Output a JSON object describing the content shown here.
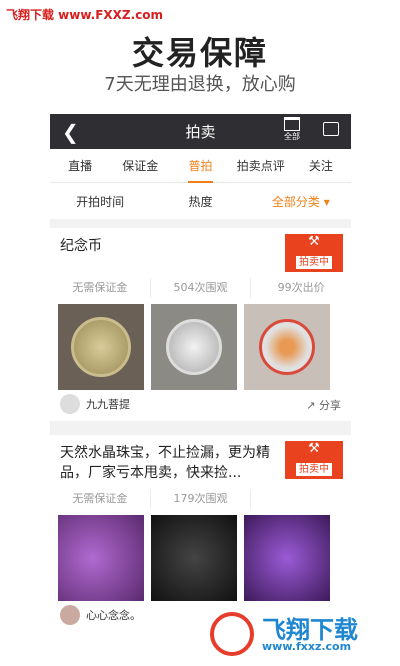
{
  "watermark_top": "飞翔下载 www.FXXZ.com",
  "promo": {
    "title": "交易保障",
    "subtitle": "7天无理由退换，放心购"
  },
  "nav": {
    "title": "拍卖",
    "calendar_label": "全部"
  },
  "tabs": [
    {
      "label": "直播"
    },
    {
      "label": "保证金"
    },
    {
      "label": "普拍",
      "active": true
    },
    {
      "label": "拍卖点评"
    },
    {
      "label": "关注"
    }
  ],
  "filters": [
    {
      "label": "开拍时间"
    },
    {
      "label": "热度"
    },
    {
      "label": "全部分类 ▾",
      "active": true
    }
  ],
  "cards": [
    {
      "name": "纪念币",
      "badge": "拍卖中",
      "stats": [
        "无需保证金",
        "504次围观",
        "99次出价"
      ],
      "owner": "九九菩提",
      "share": "分享"
    },
    {
      "name": "天然水晶珠宝，不止捡漏，更为精品，厂家亏本甩卖，快来捡...",
      "badge": "拍卖中",
      "stats": [
        "无需保证金",
        "179次围观",
        ""
      ],
      "owner": "心心念念。"
    }
  ],
  "logo_watermark": {
    "brand": "飞翔下载",
    "url": "www.fxxz.com"
  },
  "colors": {
    "accent": "#f08019",
    "badge": "#e8421e",
    "nav": "#2f2f33"
  }
}
